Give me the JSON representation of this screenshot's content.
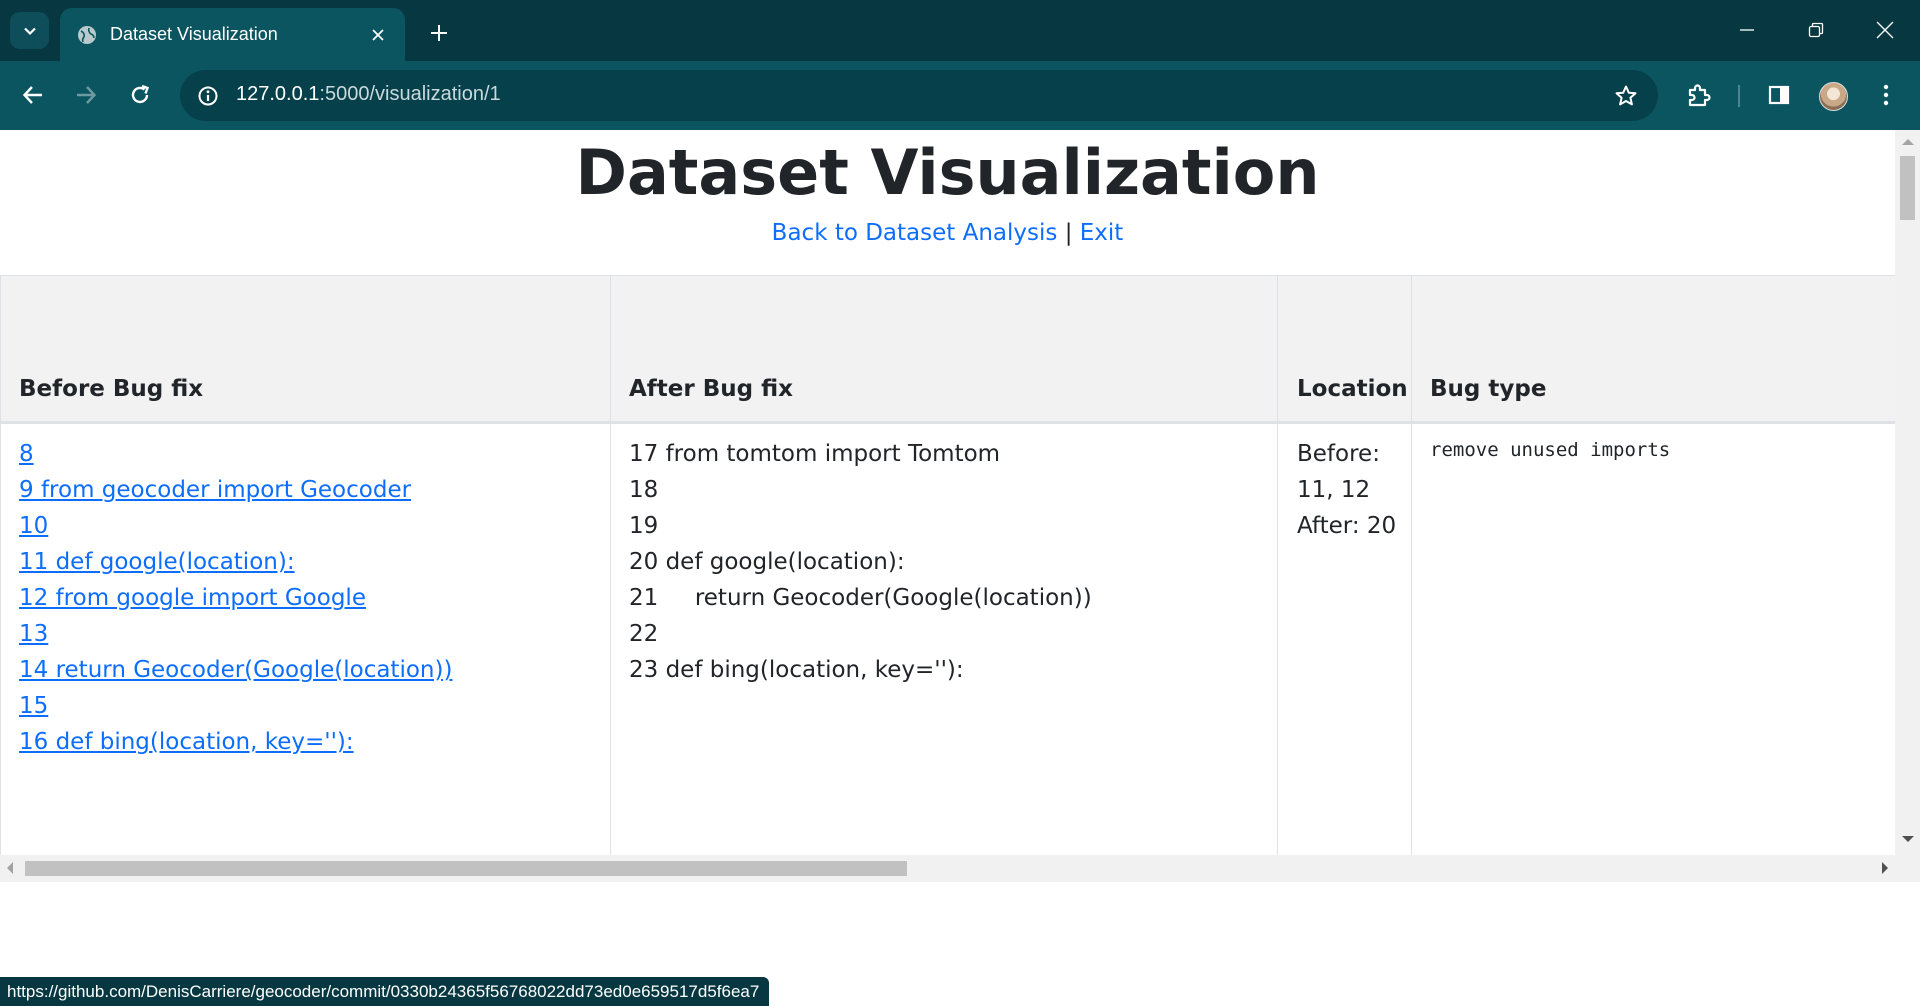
{
  "browser": {
    "tab_title": "Dataset Visualization",
    "url_host": "127.0.0.1",
    "url_rest": ":5000/visualization/1",
    "status_url": "https://github.com/DenisCarriere/geocoder/commit/0330b24365f56768022dd73ed0e659517d5f6ea7",
    "colors": {
      "frame": "#073842",
      "toolbar": "#0b5560",
      "omnibox": "#06404a"
    }
  },
  "page": {
    "title": "Dataset Visualization",
    "back_link": "Back to Dataset Analysis",
    "separator": "|",
    "exit_link": "Exit",
    "link_color": "#0d6efd"
  },
  "table": {
    "headers": {
      "before": "Before Bug fix",
      "after": "After Bug fix",
      "location": "Location",
      "bug_type": "Bug type"
    },
    "before_lines": [
      "8",
      "9 from geocoder import Geocoder",
      "10",
      "11 def google(location):",
      "12 from google import Google",
      "13",
      "14 return Geocoder(Google(location))",
      "15",
      "16 def bing(location, key=''):"
    ],
    "after_lines": [
      "17 from tomtom import Tomtom",
      "18",
      "19",
      "20 def google(location):",
      "21     return Geocoder(Google(location))",
      "22",
      "23 def bing(location, key=''):"
    ],
    "location_lines": [
      "Before:",
      "11, 12",
      "After: 20"
    ],
    "bug_type": "remove unused imports"
  }
}
